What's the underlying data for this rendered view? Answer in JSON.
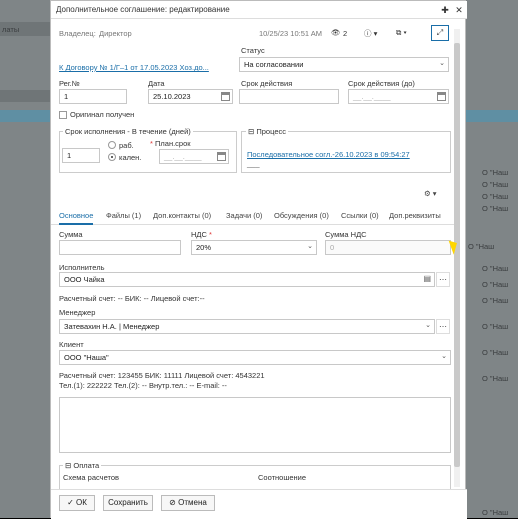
{
  "background": {
    "left_items": [
      "латы",
      "",
      ""
    ],
    "right_items": [
      "О \"Наш",
      "О \"Наш",
      "О \"Наш",
      "О \"Наш",
      "О \"Наш",
      "О \"Наш",
      "О \"Наш",
      "О \"Наш",
      "О \"Наш",
      "О \"Наш",
      "О \"Наш",
      "О \"Наш"
    ]
  },
  "dialog": {
    "title": "Дополнительное соглашение: редактирование",
    "owner_label": "Владелец:",
    "owner_value": "Директор",
    "timestamp": "10/25/23 10:51 AM",
    "views_icon": "eye-icon",
    "views_count": "2",
    "info_icon": "info-icon",
    "copy_icon": "copy-icon",
    "expand_icon": "expand-icon",
    "pin_icon": "pin-icon",
    "close_icon": "close-icon"
  },
  "form": {
    "contract_link": "К Договору № 1/Г–1 от 17.05.2023 Хоз.до...",
    "status_label": "Статус",
    "status_value": "На согласовании",
    "reg_label": "Рег.№",
    "reg_value": "1",
    "date_label": "Дата",
    "date_value": "25.10.2023",
    "term_label": "Срок действия",
    "term_value": "",
    "term_until_label": "Срок действия (до)",
    "term_until_placeholder": "__.__.____",
    "original_label": "Оригинал получен",
    "exec_legend": "Срок исполнения - В течение (дней)",
    "exec_days": "1",
    "work_label": "раб.",
    "cal_label": "кален.",
    "plan_label": "План.срок",
    "plan_placeholder": "__.__.____",
    "process_legend": "Процесс",
    "process_link": "Последовательное согл.-26.10.2023 в 09:54:27",
    "process_sub": "___",
    "settings_icon": "gear-icon"
  },
  "tabs": [
    {
      "label": "Основное"
    },
    {
      "label": "Файлы (1)"
    },
    {
      "label": "Доп.контакты (0)"
    },
    {
      "label": "Задачи (0)"
    },
    {
      "label": "Обсуждения (0)"
    },
    {
      "label": "Ссылки (0)"
    },
    {
      "label": "Доп.реквизиты"
    }
  ],
  "main": {
    "sum_label": "Сумма",
    "sum_value": "",
    "vat_label": "НДС",
    "vat_value": "20%",
    "vat_sum_label": "Сумма НДС",
    "vat_sum_value": "0",
    "executor_label": "Исполнитель",
    "executor_value": "ООО Чайка",
    "executor_accounts": "Расчетный счет: -- БИК: -- Лицевой счет:--",
    "manager_label": "Менеджер",
    "manager_value": "Затевахин Н.А. | Менеджер",
    "client_label": "Клиент",
    "client_value": "ООО \"Наша\"",
    "client_accounts": "Расчетный счет: 123455 БИК: 11111 Лицевой счет: 4543221",
    "client_phones": "Тел.(1): 222222 Тел.(2): -- Внутр.тел.: -- E-mail: --",
    "payment_legend": "Оплата",
    "scheme_label": "Схема расчетов",
    "ratio_label": "Соотношение"
  },
  "footer": {
    "ok_label": "ОК",
    "save_label": "Сохранить",
    "cancel_label": "Отмена"
  }
}
